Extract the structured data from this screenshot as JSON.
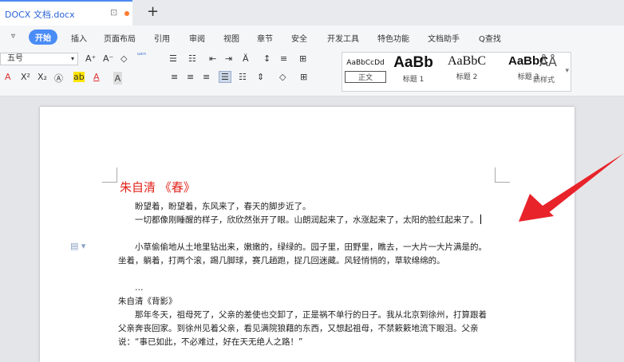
{
  "tab": {
    "file_name": "DOCX 文档.docx",
    "pin_glyph": "⊡",
    "new_tab": "+"
  },
  "menu": {
    "dropdown": "▿",
    "active": "开始",
    "items": [
      "插入",
      "页面布局",
      "引用",
      "审阅",
      "视图",
      "章节",
      "安全",
      "开发工具",
      "特色功能",
      "文档助手",
      "Q查找"
    ]
  },
  "ribbon": {
    "font_size": "五号",
    "row1_tools": [
      "A⁺",
      "A⁻",
      "◇",
      "ᵘᵉⁿ",
      "☰",
      "☷",
      "⇤",
      "⇥",
      "Ä",
      "↕",
      "≡",
      "⊞"
    ],
    "row2_tools": [
      "A",
      "X²",
      "X₂",
      "Ⓐ",
      "ab",
      "A",
      "Ａ",
      "≡",
      "≡",
      "≡",
      "☰",
      "☷",
      "⇕",
      "◇",
      "⊞"
    ],
    "styles": [
      {
        "sample": "AaBbCcDd",
        "label": "正文"
      },
      {
        "sample": "AaBb",
        "label": "标题 1"
      },
      {
        "sample": "AaBbC",
        "label": "标题 2"
      },
      {
        "sample": "AaBbC",
        "label": "标题 3"
      }
    ],
    "new_style_icon": "ÅÅ",
    "new_style_label": "新样式"
  },
  "doc": {
    "title": "朱自清 《春》",
    "p1": "盼望着，盼望着，东风来了，春天的脚步近了。",
    "p2": "一切都像刚睡醒的样子，欣欣然张开了眼。山朗润起来了，水涨起来了，太阳的脸红起来了。",
    "p3": "小草偷偷地从土地里钻出来，嫩嫩的，绿绿的。园子里，田野里，瞧去，一大片一大片满是的。坐着，躺着，打两个滚，踢几脚球，赛几趟跑，捉几回迷藏。风轻悄悄的，草软绵绵的。",
    "ellipsis": "…",
    "subtitle": "朱自清《背影》",
    "p4": "那年冬天，祖母死了，父亲的差使也交卸了，正是祸不单行的日子。我从北京到徐州，打算跟着父亲奔丧回家。到徐州见着父亲，看见满院狼藉的东西，又想起祖母，不禁簌簌地流下眼泪。父亲说：“事已如此，不必难过，好在天无绝人之路！”",
    "para_marker": "▤ ▾"
  },
  "colors": {
    "accent": "#4a8cf6",
    "title_red": "#e2231a",
    "arrow_red": "#e8232a"
  }
}
